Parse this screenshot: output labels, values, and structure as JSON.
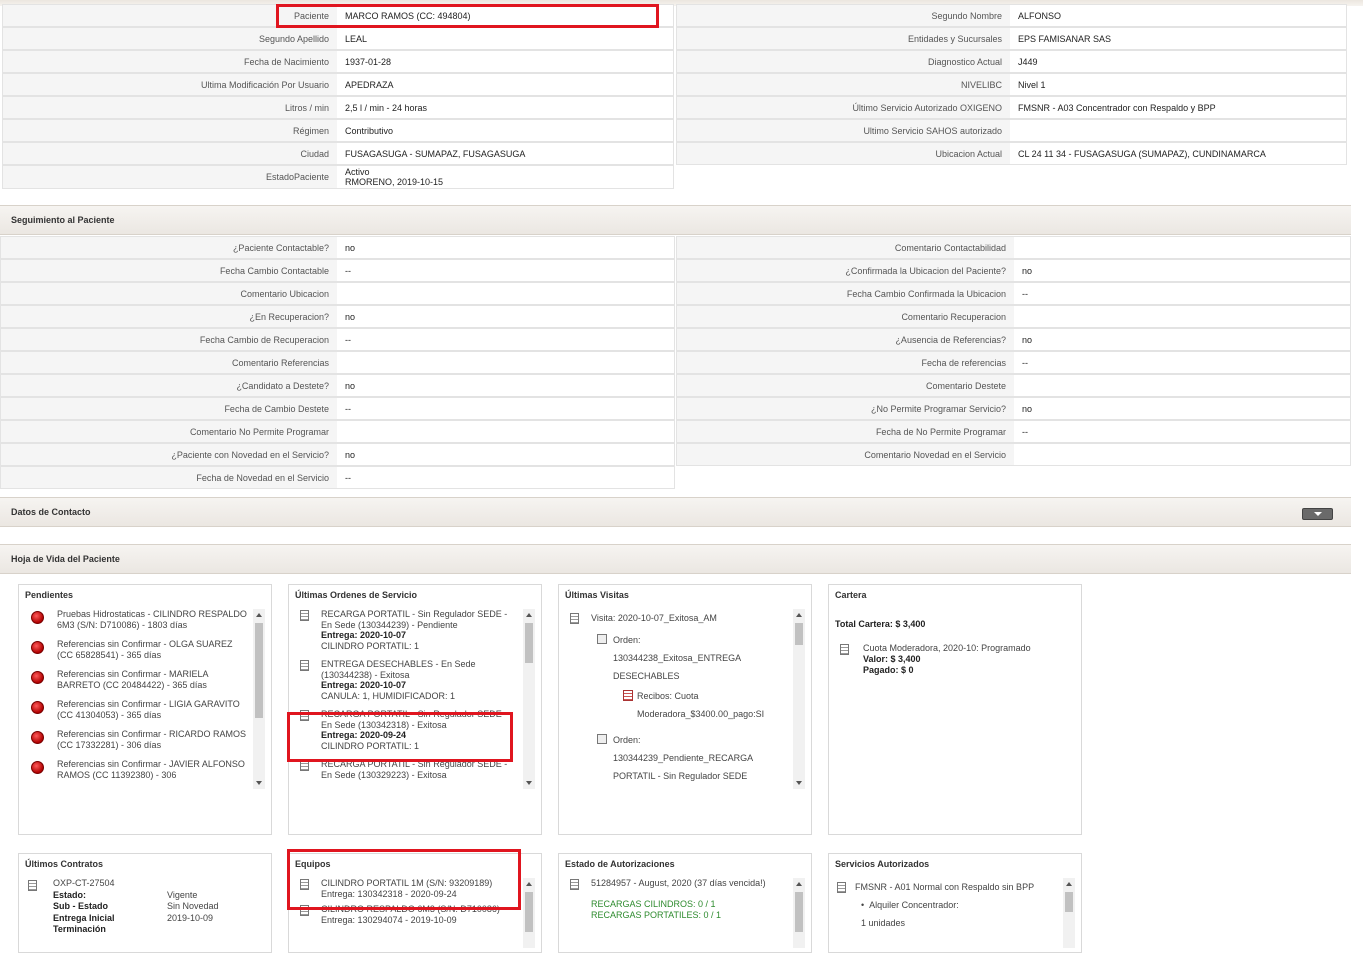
{
  "patient": {
    "left": [
      {
        "label": "Paciente",
        "value": "MARCO RAMOS (CC: 494804)"
      },
      {
        "label": "Segundo Apellido",
        "value": "LEAL"
      },
      {
        "label": "Fecha de Nacimiento",
        "value": "1937-01-28"
      },
      {
        "label": "Ultima Modificación Por Usuario",
        "value": "APEDRAZA"
      },
      {
        "label": "Litros / min",
        "value": "2,5 l / min - 24 horas"
      },
      {
        "label": "Régimen",
        "value": "Contributivo"
      },
      {
        "label": "Ciudad",
        "value": "FUSAGASUGA - SUMAPAZ, FUSAGASUGA"
      },
      {
        "label": "EstadoPaciente",
        "value": "Activo",
        "value2": "RMORENO, 2019-10-15"
      }
    ],
    "right": [
      {
        "label": "Segundo Nombre",
        "value": "ALFONSO"
      },
      {
        "label": "Entidades y Sucursales",
        "value": "EPS FAMISANAR SAS"
      },
      {
        "label": "Diagnostico Actual",
        "value": "J449"
      },
      {
        "label": "NIVELIBC",
        "value": "Nivel 1"
      },
      {
        "label": "Último Servicio Autorizado OXIGENO",
        "value": "FMSNR - A03 Concentrador con Respaldo y BPP"
      },
      {
        "label": "Ultimo Servicio SAHOS autorizado",
        "value": ""
      },
      {
        "label": "Ubicacion Actual",
        "value": "CL 24 11 34 - FUSAGASUGA (SUMAPAZ), CUNDINAMARCA"
      }
    ]
  },
  "seguimiento": {
    "title": "Seguimiento al Paciente",
    "left": [
      {
        "label": "¿Paciente Contactable?",
        "value": "no"
      },
      {
        "label": "Fecha Cambio Contactable",
        "value": "--"
      },
      {
        "label": "Comentario Ubicacion",
        "value": ""
      },
      {
        "label": "¿En Recuperacion?",
        "value": "no"
      },
      {
        "label": "Fecha Cambio de Recuperacion",
        "value": "--"
      },
      {
        "label": "Comentario Referencias",
        "value": ""
      },
      {
        "label": "¿Candidato a Destete?",
        "value": "no"
      },
      {
        "label": "Fecha de Cambio Destete",
        "value": "--"
      },
      {
        "label": "Comentario No Permite Programar",
        "value": ""
      },
      {
        "label": "¿Paciente con Novedad en el Servicio?",
        "value": "no"
      },
      {
        "label": "Fecha de Novedad en el Servicio",
        "value": "--"
      }
    ],
    "right": [
      {
        "label": "Comentario Contactabilidad",
        "value": ""
      },
      {
        "label": "¿Confirmada la Ubicacion del Paciente?",
        "value": "no"
      },
      {
        "label": "Fecha Cambio Confirmada la Ubicacion",
        "value": "--"
      },
      {
        "label": "Comentario Recuperacion",
        "value": ""
      },
      {
        "label": "¿Ausencia de Referencias?",
        "value": "no"
      },
      {
        "label": "Fecha de referencias",
        "value": "--"
      },
      {
        "label": "Comentario Destete",
        "value": ""
      },
      {
        "label": "¿No Permite Programar Servicio?",
        "value": "no"
      },
      {
        "label": "Fecha de No Permite Programar",
        "value": "--"
      },
      {
        "label": "Comentario Novedad en el Servicio",
        "value": ""
      }
    ]
  },
  "contacto": {
    "title": "Datos de Contacto"
  },
  "hoja": {
    "title": "Hoja de Vida del Paciente"
  },
  "pendientes": {
    "title": "Pendientes",
    "items": [
      "Pruebas Hidrostaticas - CILINDRO RESPALDO 6M3 (S/N: D710086) - 1803 días",
      "Referencias sin Confirmar - OLGA SUAREZ (CC 65828541) - 365 días",
      "Referencias sin Confirmar - MARIELA BARRETO (CC 20484422) - 365 días",
      "Referencias sin Confirmar - LIGIA GARAVITO (CC 41304053) - 365 días",
      "Referencias sin Confirmar - RICARDO RAMOS (CC 17332281) - 306 días",
      "Referencias sin Confirmar - JAVIER ALFONSO RAMOS (CC 11392380) - 306"
    ]
  },
  "ordenes": {
    "title": "Últimas Ordenes de Servicio",
    "items": [
      {
        "text": "RECARGA PORTATIL - Sin Regulador SEDE - En Sede (130344239) - Pendiente",
        "entrega": "Entrega: 2020-10-07",
        "detail": "CILINDRO PORTATIL: 1"
      },
      {
        "text": "ENTREGA DESECHABLES - En Sede (130344238) - Exitosa",
        "entrega": "Entrega: 2020-10-07",
        "detail": "CANULA: 1, HUMIDIFICADOR: 1"
      },
      {
        "text": "RECARGA PORTATIL - Sin Regulador SEDE - En Sede (130342318) - Exitosa",
        "entrega": "Entrega: 2020-09-24",
        "detail": "CILINDRO PORTATIL: 1"
      },
      {
        "text": "RECARGA PORTATIL - Sin Regulador SEDE - En Sede (130329223) - Exitosa",
        "entrega": "",
        "detail": ""
      }
    ]
  },
  "visitas": {
    "title": "Últimas Visitas",
    "visit": "Visita: 2020-10-07_Exitosa_AM",
    "orden_label": "Orden:",
    "orden1": "130344238_Exitosa_ENTREGA DESECHABLES",
    "recibos": "Recibos: Cuota Moderadora_$3400.00_pago:SI",
    "orden2": "130344239_Pendiente_RECARGA PORTATIL - Sin Regulador SEDE"
  },
  "cartera": {
    "title": "Cartera",
    "total": "Total Cartera: $ 3,400",
    "item": "Cuota Moderadora, 2020-10: Programado",
    "valor": "Valor: $ 3,400",
    "pagado": "Pagado: $ 0"
  },
  "contratos": {
    "title": "Últimos Contratos",
    "id": "OXP-CT-27504",
    "estado_label": "Estado:",
    "estado": "Vigente",
    "subestado_label": "Sub - Estado",
    "subestado": "Sin Novedad",
    "entrega_label": "Entrega Inicial",
    "entrega": "2019-10-09",
    "terminacion_label": "Terminación"
  },
  "equipos": {
    "title": "Equipos",
    "item1": "CILINDRO PORTATIL 1M (S/N: 93209189)",
    "item1b": "Entrega: 130342318 - 2020-09-24",
    "item2": "CILINDRO RESPALDO 6M3 (S/N: D710086)",
    "item2b": "Entrega: 130294074 - 2019-10-09"
  },
  "autorizaciones": {
    "title": "Estado de Autorizaciones",
    "item": "51284957 - August, 2020 (37 días vencida!)",
    "line1": "RECARGAS CILINDROS: 0 / 1",
    "line2": "RECARGAS PORTATILES: 0 / 1"
  },
  "servicios": {
    "title": "Servicios Autorizados",
    "item": "FMSNR - A01 Normal con Respaldo sin BPP",
    "sub": "Alquiler Concentrador:",
    "qty": "1 unidades"
  }
}
